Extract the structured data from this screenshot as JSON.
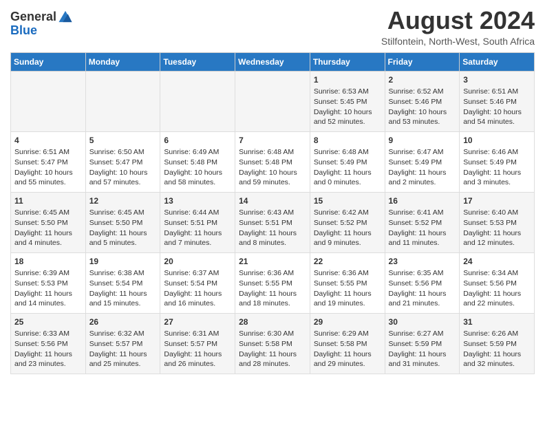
{
  "header": {
    "logo_general": "General",
    "logo_blue": "Blue",
    "main_title": "August 2024",
    "subtitle": "Stilfontein, North-West, South Africa"
  },
  "columns": [
    "Sunday",
    "Monday",
    "Tuesday",
    "Wednesday",
    "Thursday",
    "Friday",
    "Saturday"
  ],
  "weeks": [
    {
      "days": [
        {
          "num": "",
          "content": ""
        },
        {
          "num": "",
          "content": ""
        },
        {
          "num": "",
          "content": ""
        },
        {
          "num": "",
          "content": ""
        },
        {
          "num": "1",
          "content": "Sunrise: 6:53 AM\nSunset: 5:45 PM\nDaylight: 10 hours and 52 minutes."
        },
        {
          "num": "2",
          "content": "Sunrise: 6:52 AM\nSunset: 5:46 PM\nDaylight: 10 hours and 53 minutes."
        },
        {
          "num": "3",
          "content": "Sunrise: 6:51 AM\nSunset: 5:46 PM\nDaylight: 10 hours and 54 minutes."
        }
      ]
    },
    {
      "days": [
        {
          "num": "4",
          "content": "Sunrise: 6:51 AM\nSunset: 5:47 PM\nDaylight: 10 hours and 55 minutes."
        },
        {
          "num": "5",
          "content": "Sunrise: 6:50 AM\nSunset: 5:47 PM\nDaylight: 10 hours and 57 minutes."
        },
        {
          "num": "6",
          "content": "Sunrise: 6:49 AM\nSunset: 5:48 PM\nDaylight: 10 hours and 58 minutes."
        },
        {
          "num": "7",
          "content": "Sunrise: 6:48 AM\nSunset: 5:48 PM\nDaylight: 10 hours and 59 minutes."
        },
        {
          "num": "8",
          "content": "Sunrise: 6:48 AM\nSunset: 5:49 PM\nDaylight: 11 hours and 0 minutes."
        },
        {
          "num": "9",
          "content": "Sunrise: 6:47 AM\nSunset: 5:49 PM\nDaylight: 11 hours and 2 minutes."
        },
        {
          "num": "10",
          "content": "Sunrise: 6:46 AM\nSunset: 5:49 PM\nDaylight: 11 hours and 3 minutes."
        }
      ]
    },
    {
      "days": [
        {
          "num": "11",
          "content": "Sunrise: 6:45 AM\nSunset: 5:50 PM\nDaylight: 11 hours and 4 minutes."
        },
        {
          "num": "12",
          "content": "Sunrise: 6:45 AM\nSunset: 5:50 PM\nDaylight: 11 hours and 5 minutes."
        },
        {
          "num": "13",
          "content": "Sunrise: 6:44 AM\nSunset: 5:51 PM\nDaylight: 11 hours and 7 minutes."
        },
        {
          "num": "14",
          "content": "Sunrise: 6:43 AM\nSunset: 5:51 PM\nDaylight: 11 hours and 8 minutes."
        },
        {
          "num": "15",
          "content": "Sunrise: 6:42 AM\nSunset: 5:52 PM\nDaylight: 11 hours and 9 minutes."
        },
        {
          "num": "16",
          "content": "Sunrise: 6:41 AM\nSunset: 5:52 PM\nDaylight: 11 hours and 11 minutes."
        },
        {
          "num": "17",
          "content": "Sunrise: 6:40 AM\nSunset: 5:53 PM\nDaylight: 11 hours and 12 minutes."
        }
      ]
    },
    {
      "days": [
        {
          "num": "18",
          "content": "Sunrise: 6:39 AM\nSunset: 5:53 PM\nDaylight: 11 hours and 14 minutes."
        },
        {
          "num": "19",
          "content": "Sunrise: 6:38 AM\nSunset: 5:54 PM\nDaylight: 11 hours and 15 minutes."
        },
        {
          "num": "20",
          "content": "Sunrise: 6:37 AM\nSunset: 5:54 PM\nDaylight: 11 hours and 16 minutes."
        },
        {
          "num": "21",
          "content": "Sunrise: 6:36 AM\nSunset: 5:55 PM\nDaylight: 11 hours and 18 minutes."
        },
        {
          "num": "22",
          "content": "Sunrise: 6:36 AM\nSunset: 5:55 PM\nDaylight: 11 hours and 19 minutes."
        },
        {
          "num": "23",
          "content": "Sunrise: 6:35 AM\nSunset: 5:56 PM\nDaylight: 11 hours and 21 minutes."
        },
        {
          "num": "24",
          "content": "Sunrise: 6:34 AM\nSunset: 5:56 PM\nDaylight: 11 hours and 22 minutes."
        }
      ]
    },
    {
      "days": [
        {
          "num": "25",
          "content": "Sunrise: 6:33 AM\nSunset: 5:56 PM\nDaylight: 11 hours and 23 minutes."
        },
        {
          "num": "26",
          "content": "Sunrise: 6:32 AM\nSunset: 5:57 PM\nDaylight: 11 hours and 25 minutes."
        },
        {
          "num": "27",
          "content": "Sunrise: 6:31 AM\nSunset: 5:57 PM\nDaylight: 11 hours and 26 minutes."
        },
        {
          "num": "28",
          "content": "Sunrise: 6:30 AM\nSunset: 5:58 PM\nDaylight: 11 hours and 28 minutes."
        },
        {
          "num": "29",
          "content": "Sunrise: 6:29 AM\nSunset: 5:58 PM\nDaylight: 11 hours and 29 minutes."
        },
        {
          "num": "30",
          "content": "Sunrise: 6:27 AM\nSunset: 5:59 PM\nDaylight: 11 hours and 31 minutes."
        },
        {
          "num": "31",
          "content": "Sunrise: 6:26 AM\nSunset: 5:59 PM\nDaylight: 11 hours and 32 minutes."
        }
      ]
    }
  ]
}
